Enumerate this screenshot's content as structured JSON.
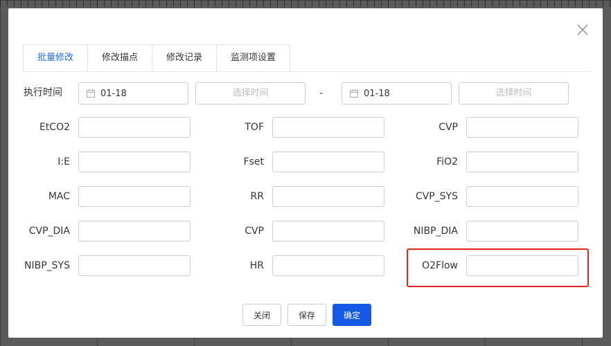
{
  "tabs": [
    {
      "label": "批量修改",
      "active": true
    },
    {
      "label": "修改描点",
      "active": false
    },
    {
      "label": "修改记录",
      "active": false
    },
    {
      "label": "监测项设置",
      "active": false
    }
  ],
  "time_row": {
    "label": "执行时间",
    "start_date": "01-18",
    "start_time_placeholder": "选择时间",
    "separator": "-",
    "end_date": "01-18",
    "end_time_placeholder": "选择时间"
  },
  "fields": [
    {
      "label": "EtCO2",
      "value": ""
    },
    {
      "label": "TOF",
      "value": ""
    },
    {
      "label": "CVP",
      "value": ""
    },
    {
      "label": "I:E",
      "value": ""
    },
    {
      "label": "Fset",
      "value": ""
    },
    {
      "label": "FiO2",
      "value": ""
    },
    {
      "label": "MAC",
      "value": ""
    },
    {
      "label": "RR",
      "value": ""
    },
    {
      "label": "CVP_SYS",
      "value": ""
    },
    {
      "label": "CVP_DIA",
      "value": ""
    },
    {
      "label": "CVP",
      "value": ""
    },
    {
      "label": "NIBP_DIA",
      "value": ""
    },
    {
      "label": "NIBP_SYS",
      "value": ""
    },
    {
      "label": "HR",
      "value": ""
    },
    {
      "label": "O2Flow",
      "value": ""
    }
  ],
  "buttons": {
    "close": "关闭",
    "save": "保存",
    "confirm": "确定"
  },
  "colors": {
    "accent": "#1559e6",
    "tab_active": "#1f6fe5",
    "highlight": "#e0231c"
  }
}
